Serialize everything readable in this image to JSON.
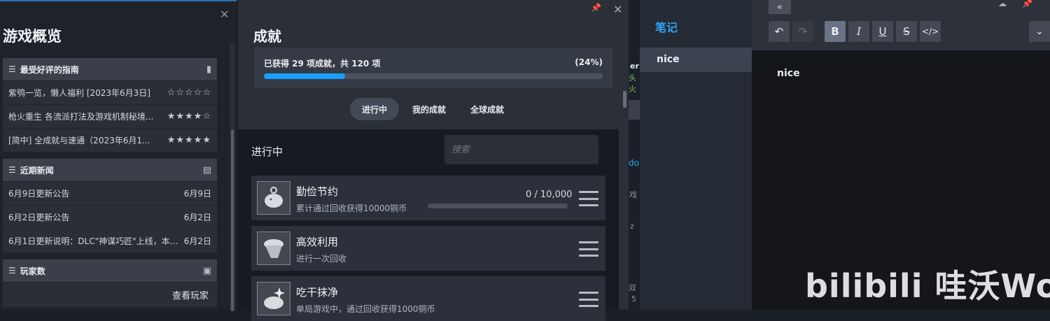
{
  "overview": {
    "title": "游戏概览",
    "guides": {
      "header": "最受好评的指南",
      "items": [
        {
          "title": "紫鸮一览，懒人福利 [2023年6月3日]",
          "stars": "☆☆☆☆☆"
        },
        {
          "title": "枪火重生 各流派打法及游戏机制秘境...",
          "stars": "★★★★☆"
        },
        {
          "title": "[简中] 全成就与速通（2023年6月1...",
          "stars": "★★★★★"
        }
      ]
    },
    "news": {
      "header": "近期新闻",
      "items": [
        {
          "title": "6月9日更新公告",
          "date": "6月9日"
        },
        {
          "title": "6月2日更新公告",
          "date": "6月2日"
        },
        {
          "title": "6月1日更新说明：DLC\"神谋巧匠\"上线，本...",
          "date": "6月2日"
        }
      ]
    },
    "players": {
      "header": "玩家数",
      "view_button": "查看玩家"
    }
  },
  "achievements": {
    "title": "成就",
    "progress_label": "已获得 29 项成就，共 120 项",
    "progress_percent_label": "(24%)",
    "progress_fraction": 0.24,
    "tabs": [
      "进行中",
      "我的成就",
      "全球成就"
    ],
    "active_tab": 0,
    "list_header": "进行中",
    "search_placeholder": "搜索",
    "items": [
      {
        "name": "勤俭节约",
        "desc": "累计通过回收获得10000铜币",
        "value": "0 / 10,000",
        "progress": 0
      },
      {
        "name": "高效利用",
        "desc": "进行一次回收"
      },
      {
        "name": "吃干抹净",
        "desc": "单局游戏中，通过回收获得1000铜币"
      }
    ]
  },
  "strip_fragments": [
    "er",
    "头火",
    "do",
    "戏",
    "z",
    "双",
    "5"
  ],
  "notes": {
    "title": "笔记",
    "selected": "nice"
  },
  "editor": {
    "content": "nice",
    "watermark": "bilibili 哇沃WoW",
    "toolbar": {
      "bold": "B",
      "italic": "I",
      "underline": "U",
      "strike": "S",
      "code": "</>"
    }
  },
  "colors": {
    "accent": "#1a9fff",
    "notes_title": "#2fa3f2"
  }
}
